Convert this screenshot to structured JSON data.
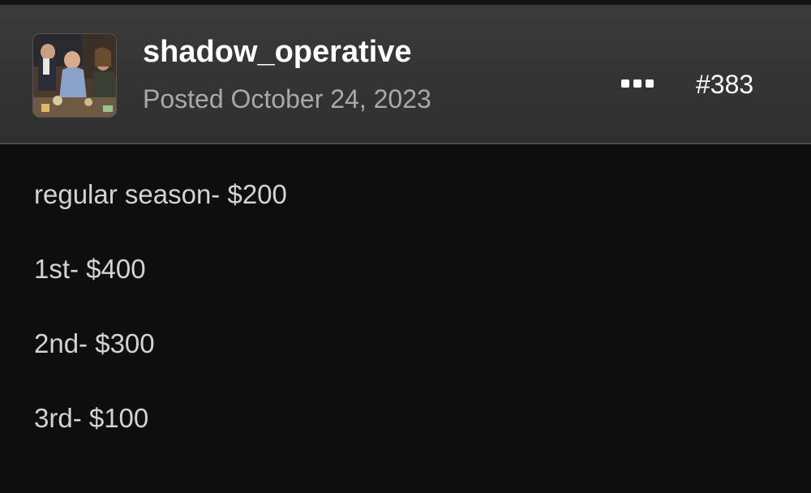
{
  "post": {
    "author": {
      "username": "shadow_operative",
      "avatar_icon": "avatar-photo-icon"
    },
    "posted": "Posted October 24, 2023",
    "post_number": "#383",
    "more_icon": "ellipsis-icon",
    "body_lines": [
      "regular season- $200",
      "1st- $400",
      "2nd- $300",
      "3rd- $100"
    ]
  },
  "colors": {
    "header_bg": "#333333",
    "body_bg": "#0e0e0e",
    "username": "#ffffff",
    "date": "#a9a9a9",
    "body_text": "#d3d3d3"
  }
}
